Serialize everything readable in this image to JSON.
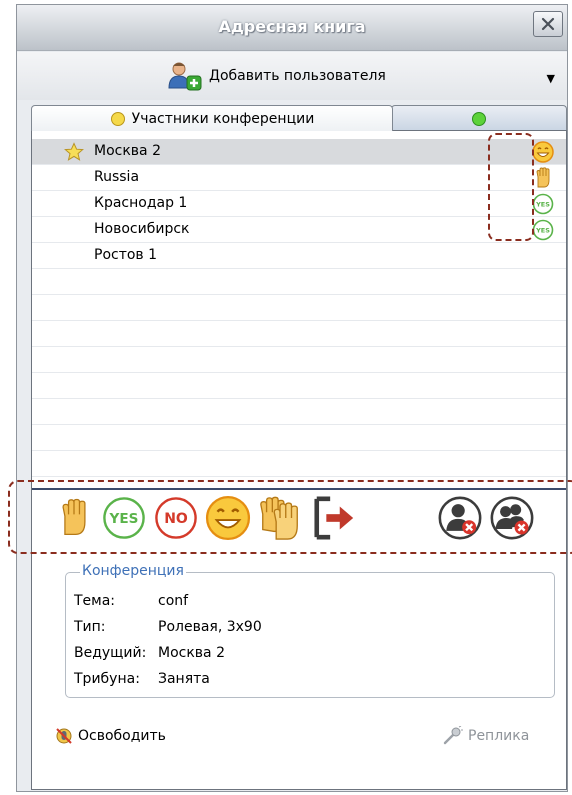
{
  "window": {
    "title": "Адресная книга"
  },
  "toolbar": {
    "add_user_label": "Добавить пользователя"
  },
  "tabs": [
    {
      "label": "Участники конференции",
      "indicator_color": "#f5d94a"
    },
    {
      "label": "",
      "indicator_color": "#5cd23a"
    }
  ],
  "participants": [
    {
      "name": "Москва 2",
      "favorite": true,
      "status_icon": "smile-icon",
      "selected": true
    },
    {
      "name": "Russia",
      "favorite": false,
      "status_icon": "hand-raise-icon",
      "selected": false
    },
    {
      "name": "Краснодар 1",
      "favorite": false,
      "status_icon": "yes-icon",
      "selected": false
    },
    {
      "name": "Новосибирск",
      "favorite": false,
      "status_icon": "yes-icon",
      "selected": false
    },
    {
      "name": "Ростов 1",
      "favorite": false,
      "status_icon": "",
      "selected": false
    }
  ],
  "actions": {
    "yes_label": "YES",
    "no_label": "NO",
    "icons": [
      "hand-raise-icon",
      "yes-icon",
      "no-icon",
      "smile-icon",
      "applause-icon",
      "exit-icon",
      "remove-user-icon",
      "remove-users-icon"
    ]
  },
  "conference": {
    "legend": "Конференция",
    "theme_label": "Тема:",
    "theme_value": "conf",
    "type_label": "Тип:",
    "type_value": "Ролевая, 3x90",
    "host_label": "Ведущий:",
    "host_value": "Москва 2",
    "tribune_label": "Трибуна:",
    "tribune_value": "Занята"
  },
  "buttons": {
    "release_label": "Освободить",
    "replica_label": "Реплика"
  },
  "colors": {
    "accent_blue": "#3f71b7",
    "annotation_dashed": "#8a2d1f",
    "yes_green": "#5ab34a",
    "no_red": "#d43a2a",
    "smile_orange": "#f3a623"
  }
}
